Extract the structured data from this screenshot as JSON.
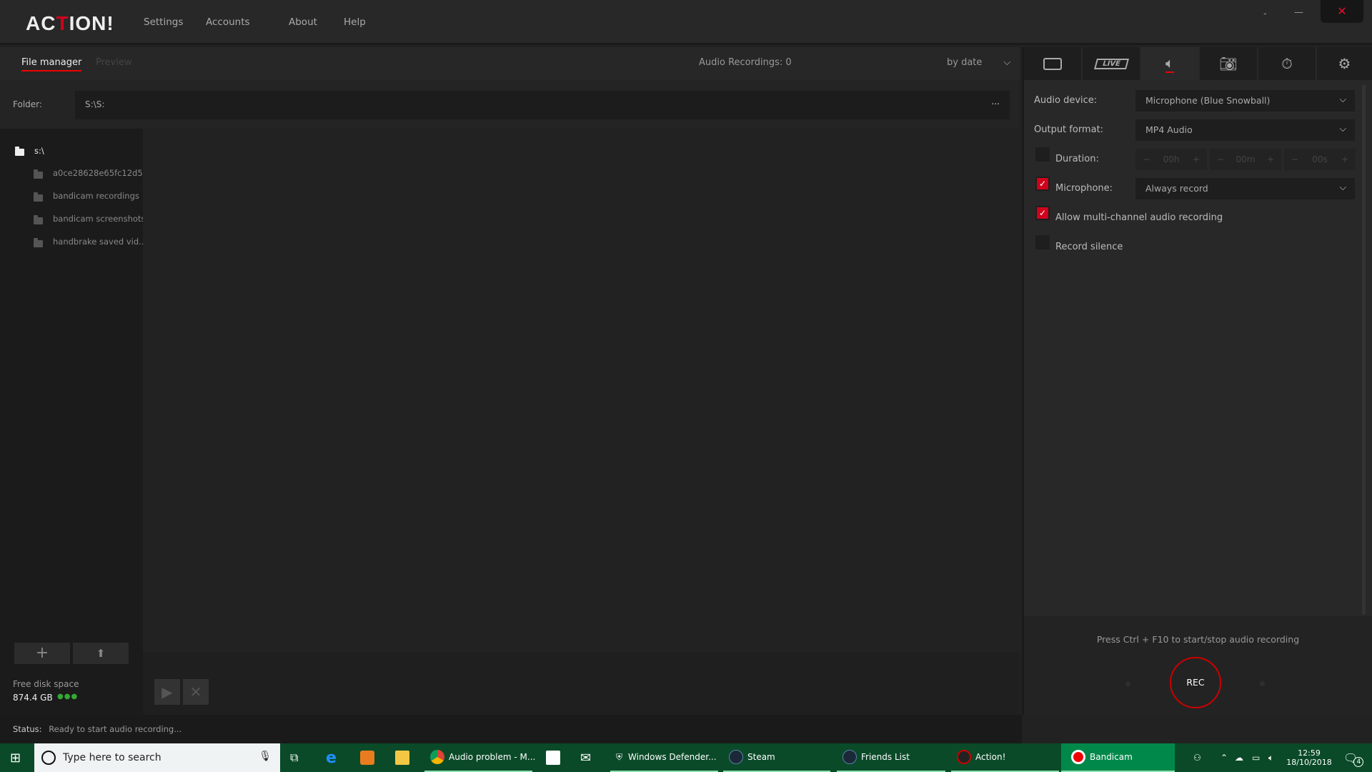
{
  "app": {
    "logo": "ACTION!",
    "menu": [
      "Settings",
      "Accounts",
      "About",
      "Help"
    ],
    "window": {
      "minimize": "-",
      "restore": "—",
      "close": "✕"
    }
  },
  "subbar": {
    "tabs": [
      "File manager",
      "Preview"
    ],
    "recordings": "Audio Recordings: 0",
    "sort": "by date"
  },
  "folder": {
    "label": "Folder:",
    "value": "S:\\S:",
    "browse": "..."
  },
  "tree": {
    "root": "s:\\",
    "items": [
      "a0ce28628e65fc12d5",
      "bandicam recordings",
      "bandicam screenshots",
      "handbrake saved vid..."
    ]
  },
  "disk": {
    "label": "Free disk space",
    "value": "874.4 GB"
  },
  "status": {
    "label": "Status:",
    "text": "Ready to start audio recording..."
  },
  "right": {
    "tabs": [
      "video",
      "live",
      "audio",
      "screenshot",
      "timer",
      "settings"
    ],
    "live_label": "LIVE",
    "audio_device_label": "Audio device:",
    "audio_device": "Microphone (Blue Snowball)",
    "output_format_label": "Output format:",
    "output_format": "MP4 Audio",
    "duration_label": "Duration:",
    "duration_checked": false,
    "duration": {
      "h": "00h",
      "m": "00m",
      "s": "00s"
    },
    "microphone_label": "Microphone:",
    "microphone_checked": true,
    "microphone_mode": "Always record",
    "multichannel_label": "Allow multi-channel audio recording",
    "multichannel_checked": true,
    "silence_label": "Record silence",
    "silence_checked": false,
    "hint": "Press Ctrl + F10 to start/stop audio recording",
    "rec": "REC"
  },
  "taskbar": {
    "search": "Type here to search",
    "windows": [
      "Audio problem - M...",
      "Windows Defender...",
      "Steam",
      "Friends List",
      "Action!",
      "Bandicam"
    ],
    "time": "12:59",
    "date": "18/10/2018",
    "notifications": "4"
  },
  "colors": {
    "accent": "#d0021b",
    "taskbar": "#0a4a28",
    "taskbar_active": "#00884a"
  }
}
